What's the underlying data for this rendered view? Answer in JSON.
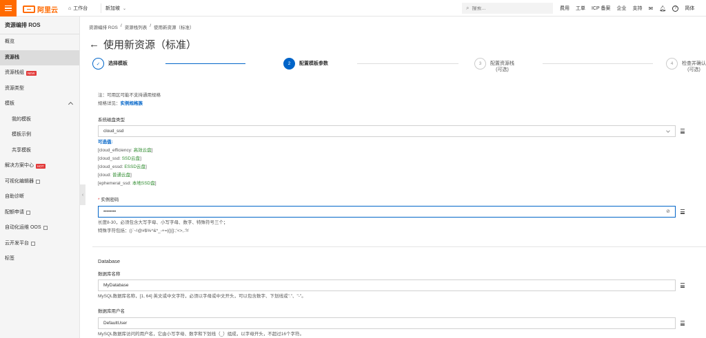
{
  "topbar": {
    "logo_text": "阿里云",
    "workspace": "工作台",
    "region": "新加坡",
    "search_placeholder": "搜索...",
    "nav": [
      "费用",
      "工单",
      "ICP 备案",
      "企业",
      "支持"
    ],
    "lang": "简体"
  },
  "sidebar": {
    "title": "资源编排 ROS",
    "items": [
      {
        "label": "概览"
      },
      {
        "label": "资源栈"
      },
      {
        "label": "资源栈组",
        "badge": "NEW"
      },
      {
        "label": "资源类型"
      },
      {
        "label": "模板"
      },
      {
        "label": "我的模板"
      },
      {
        "label": "模板示例"
      },
      {
        "label": "共享模板"
      },
      {
        "label": "解决方案中心",
        "badge": "HOT"
      },
      {
        "label": "可视化编辑器"
      },
      {
        "label": "自助诊断"
      },
      {
        "label": "配额申请"
      },
      {
        "label": "自动化运维 OOS"
      },
      {
        "label": "云开发平台"
      },
      {
        "label": "标签"
      }
    ]
  },
  "breadcrumb": [
    "资源编排 ROS",
    "/",
    "资源栈列表",
    "/",
    "使用新资源（标准）"
  ],
  "page_title": "使用新资源（标准）",
  "steps": [
    {
      "num": "✓",
      "label": "选择模板",
      "label2": ""
    },
    {
      "num": "2",
      "label": "配置模板参数",
      "label2": ""
    },
    {
      "num": "3",
      "label": "配置资源栈",
      "label2": "(可选)"
    },
    {
      "num": "4",
      "label": "检查并确认",
      "label2": "(可选)"
    }
  ],
  "form": {
    "note1": "注：可用区可能不支持通用规格",
    "note2_prefix": "规格详见：",
    "note2_link": "实例规格族",
    "disk_label": "系统磁盘类型",
    "disk_value": "cloud_ssd",
    "allowed_title": "可选值:",
    "allowed": [
      {
        "key": "[cloud_efficiency: ",
        "val": "高效云盘",
        "end": "]"
      },
      {
        "key": "[cloud_ssd: ",
        "val": "SSD云盘",
        "end": "]"
      },
      {
        "key": "[cloud_essd: ",
        "val": "ESSD云盘",
        "end": "]"
      },
      {
        "key": "[cloud: ",
        "val": "普通云盘",
        "end": "]"
      },
      {
        "key": "[ephemeral_ssd: ",
        "val": "本地SSD盘",
        "end": "]"
      }
    ],
    "pwd_required": "*",
    "pwd_label": "实例密码",
    "pwd_value": "••••••••",
    "pwd_hint1": "长度8-30，必须包含大写字母、小写字母、数字、特殊符号三个；",
    "pwd_hint2": "特殊字符包括：()`~!@#$%^&*_-+=|{}[]:;'<>,.?/",
    "section_db": "Database",
    "dbname_label": "数据库名称",
    "dbname_value": "MyDatabase",
    "dbname_hint": "MySQL数据库名称，[1, 64] 英文或中文字符，必须以字母或中文开头，可以包含数字、下划线或\".\"、\"-\"。",
    "dbuser_label": "数据库用户名",
    "dbuser_value": "DefaultUser",
    "dbuser_hint": "MySQL数据库访问的用户名，它由小写字母、数字和下划线（_）组成，以字母开头，不超过16个字符。"
  }
}
